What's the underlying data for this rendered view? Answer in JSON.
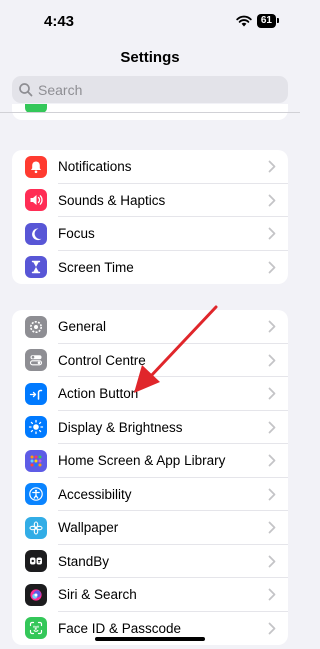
{
  "status": {
    "time": "4:43",
    "battery": "61"
  },
  "header": {
    "title": "Settings"
  },
  "search": {
    "placeholder": "Search"
  },
  "groups": [
    {
      "items": [
        {
          "label": "Notifications",
          "icon": "bell-icon",
          "color": "#ff3b30"
        },
        {
          "label": "Sounds & Haptics",
          "icon": "speaker-icon",
          "color": "#ff2d55"
        },
        {
          "label": "Focus",
          "icon": "moon-icon",
          "color": "#5856d6"
        },
        {
          "label": "Screen Time",
          "icon": "hourglass-icon",
          "color": "#5856d6"
        }
      ]
    },
    {
      "items": [
        {
          "label": "General",
          "icon": "gear-icon",
          "color": "#8e8e93"
        },
        {
          "label": "Control Centre",
          "icon": "toggles-icon",
          "color": "#8e8e93"
        },
        {
          "label": "Action Button",
          "icon": "action-button-icon",
          "color": "#007aff"
        },
        {
          "label": "Display & Brightness",
          "icon": "sun-icon",
          "color": "#007aff"
        },
        {
          "label": "Home Screen & App Library",
          "icon": "app-grid-icon",
          "color": "#5e5ce6"
        },
        {
          "label": "Accessibility",
          "icon": "accessibility-icon",
          "color": "#0a84ff"
        },
        {
          "label": "Wallpaper",
          "icon": "flower-icon",
          "color": "#32ade6"
        },
        {
          "label": "StandBy",
          "icon": "standby-icon",
          "color": "#1c1c1e"
        },
        {
          "label": "Siri & Search",
          "icon": "siri-icon",
          "color": "#1c1c1e"
        },
        {
          "label": "Face ID & Passcode",
          "icon": "face-id-icon",
          "color": "#34c759"
        }
      ]
    }
  ]
}
